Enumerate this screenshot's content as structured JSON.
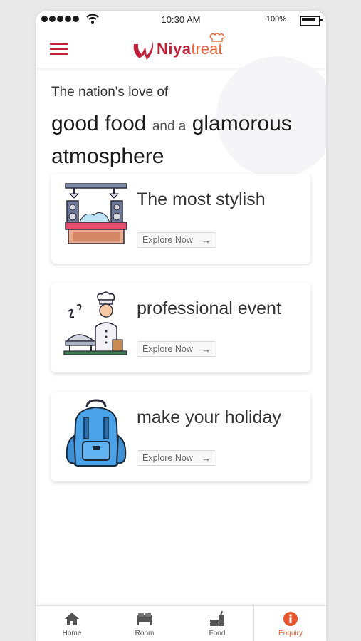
{
  "status_bar": {
    "time": "10:30 AM",
    "battery": "100%"
  },
  "header": {
    "logo_part1": "Niya",
    "logo_part2": "treat",
    "brand_color": "#c0203a",
    "accent_color": "#e8683a",
    "menu_icon": "hamburger-icon"
  },
  "hero": {
    "line1": "The nation's love of",
    "phrase_a": "good food",
    "connector": "and a",
    "phrase_b": "glamorous",
    "phrase_c": "atmosphere"
  },
  "cards": [
    {
      "title": "The most stylish",
      "button": "Explore Now",
      "icon": "stage-venue-icon"
    },
    {
      "title": "professional event",
      "button": "Explore Now",
      "icon": "chef-catering-icon"
    },
    {
      "title": "make your holiday",
      "button": "Explore Now",
      "icon": "backpack-icon"
    }
  ],
  "tabs": [
    {
      "label": "Home",
      "icon": "home-icon"
    },
    {
      "label": "Room",
      "icon": "bed-icon"
    },
    {
      "label": "Food",
      "icon": "food-drink-icon"
    },
    {
      "label": "Enquiry",
      "icon": "info-icon",
      "active": true,
      "active_color": "#e8552c"
    }
  ]
}
